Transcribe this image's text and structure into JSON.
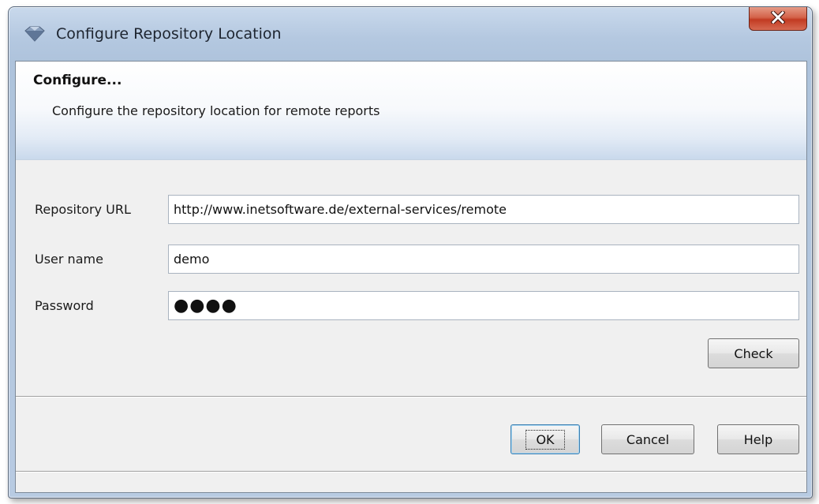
{
  "window": {
    "title": "Configure Repository Location"
  },
  "banner": {
    "heading": "Configure...",
    "description": "Configure the repository location for remote reports"
  },
  "form": {
    "repository_url": {
      "label": "Repository URL",
      "value": "http://www.inetsoftware.de/external-services/remote"
    },
    "user_name": {
      "label": "User name",
      "value": "demo"
    },
    "password": {
      "label": "Password",
      "masked_value": "●●●●"
    },
    "check_label": "Check"
  },
  "buttons": {
    "ok_label": "OK",
    "cancel_label": "Cancel",
    "help_label": "Help"
  },
  "colors": {
    "close_button": "#c23b22",
    "title_bar": "#b4c8e0"
  },
  "icons": {
    "app": "diamond-icon",
    "close": "close-icon"
  }
}
